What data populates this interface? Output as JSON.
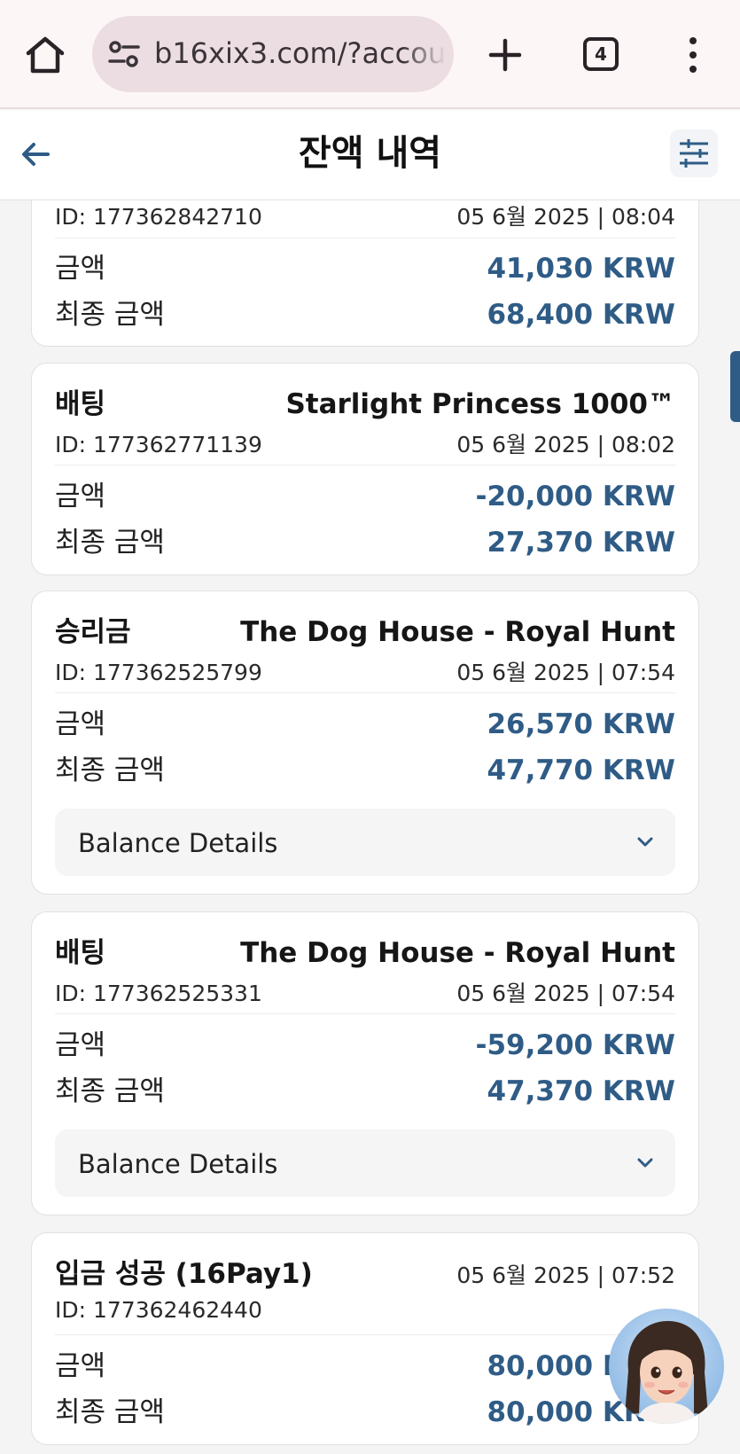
{
  "browser": {
    "url": "b16xix3.com/?accou",
    "tab_count": "4"
  },
  "header": {
    "title": "잔액 내역"
  },
  "cards": [
    {
      "type": "",
      "game": "",
      "id": "ID: 177362842710",
      "datetime": "05 6월 2025 | 08:04",
      "amount_label": "금액",
      "amount": "41,030 KRW",
      "final_label": "최종 금액",
      "final_amount": "68,400 KRW"
    },
    {
      "type": "배팅",
      "game": "Starlight Princess 1000™",
      "id": "ID: 177362771139",
      "datetime": "05 6월 2025 | 08:02",
      "amount_label": "금액",
      "amount": "-20,000 KRW",
      "final_label": "최종 금액",
      "final_amount": "27,370 KRW"
    },
    {
      "type": "승리금",
      "game": "The Dog House - Royal Hunt",
      "id": "ID: 177362525799",
      "datetime": "05 6월 2025 | 07:54",
      "amount_label": "금액",
      "amount": "26,570 KRW",
      "final_label": "최종 금액",
      "final_amount": "47,770 KRW",
      "details_label": "Balance Details"
    },
    {
      "type": "배팅",
      "game": "The Dog House - Royal Hunt",
      "id": "ID: 177362525331",
      "datetime": "05 6월 2025 | 07:54",
      "amount_label": "금액",
      "amount": "-59,200 KRW",
      "final_label": "최종 금액",
      "final_amount": "47,370 KRW",
      "details_label": "Balance Details"
    },
    {
      "type": "입금 성공 (16Pay1)",
      "game": "",
      "id": "ID: 177362462440",
      "datetime": "05 6월 2025 | 07:52",
      "amount_label": "금액",
      "amount": "80,000 KRW",
      "final_label": "최종 금액",
      "final_amount": "80,000 KRW"
    }
  ],
  "icons": {
    "home": "home-icon",
    "site_settings": "tune-icon",
    "new_tab": "plus-icon",
    "menu": "more-vert-icon",
    "back": "arrow-left-icon",
    "filter": "sliders-icon",
    "expand": "chevron-down-icon",
    "assistant": "assistant-avatar"
  },
  "colors": {
    "accent": "#2f5c86",
    "url_pill": "#ecdde3",
    "background": "#f4f4f5"
  }
}
